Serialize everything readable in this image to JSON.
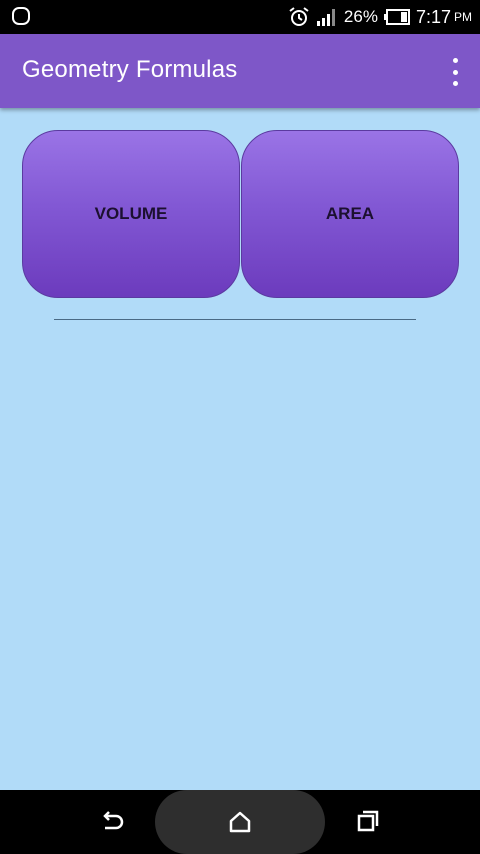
{
  "status_bar": {
    "battery": "26%",
    "time": "7:17",
    "ampm": "PM"
  },
  "app_bar": {
    "title": "Geometry Formulas"
  },
  "tiles": [
    {
      "label": "VOLUME"
    },
    {
      "label": "AREA"
    }
  ],
  "colors": {
    "app_bar": "#7e57c8",
    "background": "#b1dbf8",
    "tile_top": "#9a74e6",
    "tile_bottom": "#6c3bbd"
  },
  "icons": {
    "status_left": "notification-app-icon",
    "alarm": "alarm-icon",
    "signal": "signal-icon",
    "battery": "battery-icon",
    "overflow": "more-vert-icon",
    "back": "back-icon",
    "home": "home-icon",
    "recent": "recent-apps-icon"
  }
}
